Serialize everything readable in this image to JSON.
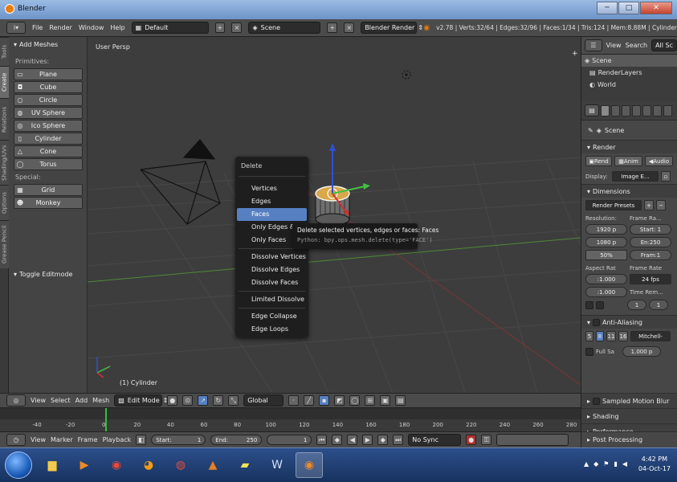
{
  "window": {
    "title": "Blender",
    "minimize": "─",
    "maximize": "□",
    "close": "✕"
  },
  "infobar": {
    "menus": [
      "File",
      "Render",
      "Window",
      "Help"
    ],
    "layout": "Default",
    "scene": "Scene",
    "engine": "Blender Render",
    "stats": "v2.78 | Verts:32/64 | Edges:32/96 | Faces:1/34 | Tris:124 | Mem:8.88M | Cylinder"
  },
  "left_tabs": [
    "Tools",
    "Create",
    "Relations",
    "Shading/UVs",
    "Options",
    "Grease Pencil"
  ],
  "toolshelf": {
    "header": "Add Meshes",
    "primitives_label": "Primitives:",
    "primitives": [
      "Plane",
      "Cube",
      "Circle",
      "UV Sphere",
      "Ico Sphere",
      "Cylinder",
      "Cone",
      "Torus"
    ],
    "special_label": "Special:",
    "special": [
      "Grid",
      "Monkey"
    ],
    "toggle": "Toggle Editmode"
  },
  "viewport": {
    "view_name": "User Persp",
    "object_label": "(1) Cylinder"
  },
  "context_menu": {
    "title": "Delete",
    "group1": [
      "Vertices",
      "Edges",
      "Faces",
      "Only Edges & F",
      "Only Faces"
    ],
    "group2": [
      "Dissolve Vertices",
      "Dissolve Edges",
      "Dissolve Faces"
    ],
    "group3": [
      "Limited Dissolve"
    ],
    "group4": [
      "Edge Collapse",
      "Edge Loops"
    ],
    "highlighted": "Faces"
  },
  "tooltip": {
    "line1": "Delete selected vertices, edges or faces:  Faces",
    "line2": "Python: bpy.ops.mesh.delete(type='FACE')"
  },
  "outliner": {
    "view": "View",
    "search": "Search",
    "filter": "All Sc",
    "rows": [
      "Scene",
      "RenderLayers",
      "World"
    ]
  },
  "properties": {
    "breadcrumb": "Scene",
    "render_header": "Render",
    "render_btn": "Rend",
    "anim_btn": "Anim",
    "audio_btn": "Audio",
    "display_label": "Display:",
    "display_value": "Image E...",
    "dimensions_header": "Dimensions",
    "presets": "Render Presets",
    "resolution_label": "Resolution:",
    "frame_range_label": "Frame Ra...",
    "res_x": "1920 p",
    "res_y": "1080 p",
    "res_pct": "50%",
    "start": "Start: 1",
    "end": "En:250",
    "step": "Fram:1",
    "aspect_label": "Aspect Rat",
    "frame_rate_label": "Frame Rate",
    "aspect_x": ":1.000",
    "aspect_y": ":1.000",
    "fps": "24 fps",
    "time_remap": "Time Rem...",
    "remap_val": "1",
    "aa_header": "Anti-Aliasing",
    "aa_samples": [
      "5",
      "8",
      "11",
      "16"
    ],
    "aa_filter": "Mitchell-",
    "full_sample": "Full Sa",
    "filter_size": "1.000 p",
    "sampled_motion": "Sampled Motion Blur",
    "shading": "Shading",
    "performance": "Performance",
    "post_processing": "Post Processing"
  },
  "vpheader": {
    "view": "View",
    "select": "Select",
    "add": "Add",
    "mesh": "Mesh",
    "mode": "Edit Mode",
    "orientation": "Global"
  },
  "timeline": {
    "ticks": [
      "-40",
      "-20",
      "0",
      "20",
      "40",
      "60",
      "80",
      "100",
      "120",
      "140",
      "160",
      "180",
      "200",
      "220",
      "240",
      "260",
      "280"
    ]
  },
  "tlheader": {
    "view": "View",
    "marker": "Marker",
    "frame": "Frame",
    "playback": "Playback",
    "start_label": "Start:",
    "start_val": "1",
    "end_label": "End:",
    "end_val": "250",
    "current": "1",
    "sync": "No Sync"
  },
  "taskbar": {
    "time": "4:42 PM",
    "date": "04-Oct-17"
  },
  "colors": {
    "selection": "#5680c2",
    "viewport_bg": "#3d3d3d",
    "x_axis": "#b33a3a",
    "y_axis": "#5fa83c"
  }
}
